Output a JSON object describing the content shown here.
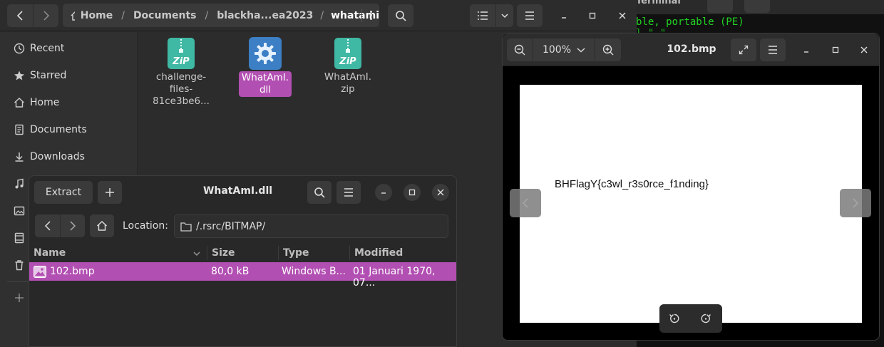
{
  "terminal": {
    "title": "Terminal",
    "lines": [
      "ble, portable (PE)"
    ]
  },
  "nautilus": {
    "breadcrumbs": [
      "Home",
      "/",
      "Documents",
      "/",
      "blackha...ea2023",
      "/",
      "whatami"
    ],
    "sidebar": [
      {
        "icon": "clock-icon",
        "label": "Recent"
      },
      {
        "icon": "star-icon",
        "label": "Starred"
      },
      {
        "icon": "home-icon",
        "label": "Home"
      },
      {
        "icon": "document-icon",
        "label": "Documents"
      },
      {
        "icon": "download-icon",
        "label": "Downloads"
      },
      {
        "icon": "music-icon",
        "label": ""
      },
      {
        "icon": "picture-icon",
        "label": ""
      },
      {
        "icon": "video-icon",
        "label": ""
      },
      {
        "icon": "trash-icon",
        "label": ""
      },
      {
        "icon": "plus-icon",
        "label": ""
      }
    ],
    "files": [
      {
        "line1": "challenge-",
        "line2": "files-",
        "line3": "81ce3be6...",
        "icon": "zip-icon",
        "selected": false
      },
      {
        "line1": "WhatAmI.",
        "line2": "dll",
        "line3": "",
        "icon": "gear-icon",
        "selected": true
      },
      {
        "line1": "WhatAmI.",
        "line2": "zip",
        "line3": "",
        "icon": "zip-icon",
        "selected": false
      }
    ],
    "zip_badge": "ZiP"
  },
  "archive": {
    "title": "WhatAmI.dll",
    "extract_label": "Extract",
    "location_label": "Location:",
    "location_value": "/.rsrc/BITMAP/",
    "columns": [
      "Name",
      "Size",
      "Type",
      "Modified"
    ],
    "rows": [
      {
        "name": "102.bmp",
        "size": "80,0 kB",
        "type": "Windows B...",
        "modified": "01 Januari 1970, 07..."
      }
    ]
  },
  "viewer": {
    "zoom": "100%",
    "title": "102.bmp",
    "image_text": "BHFlagY{c3wl_r3s0rce_f1nding}"
  },
  "colors": {
    "selection": "#b24fb2",
    "terminal_text": "#22d322",
    "zip_icon": "#3fb8a4"
  }
}
